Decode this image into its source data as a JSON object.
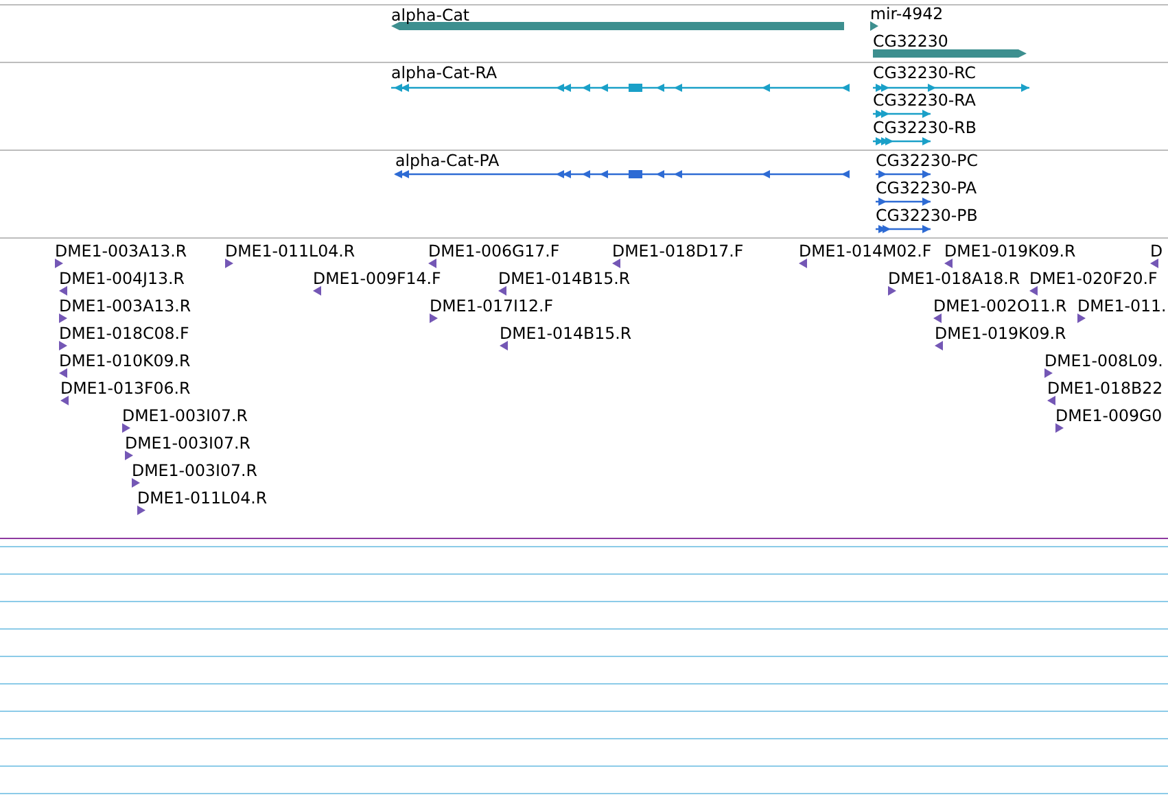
{
  "tracks": [
    {
      "kind": "genes",
      "features": [
        {
          "label": "alpha-Cat",
          "reverse": true
        },
        {
          "label": "mir-4942",
          "reverse": false
        },
        {
          "label": "CG32230",
          "reverse": false
        }
      ]
    },
    {
      "kind": "transcripts",
      "features": [
        {
          "label": "alpha-Cat-RA",
          "reverse": true
        },
        {
          "label": "CG32230-RC",
          "reverse": false
        },
        {
          "label": "CG32230-RA",
          "reverse": false
        },
        {
          "label": "CG32230-RB",
          "reverse": false
        }
      ]
    },
    {
      "kind": "proteins",
      "features": [
        {
          "label": "alpha-Cat-PA",
          "reverse": true
        },
        {
          "label": "CG32230-PC",
          "reverse": false
        },
        {
          "label": "CG32230-PA",
          "reverse": false
        },
        {
          "label": "CG32230-PB",
          "reverse": false
        }
      ]
    },
    {
      "kind": "clones",
      "features": [
        {
          "label": "DME1-003A13.R",
          "reverse": false
        },
        {
          "label": "DME1-011L04.R",
          "reverse": false
        },
        {
          "label": "DME1-006G17.F",
          "reverse": true
        },
        {
          "label": "DME1-018D17.F",
          "reverse": true
        },
        {
          "label": "DME1-014M02.F",
          "reverse": true
        },
        {
          "label": "DME1-019K09.R",
          "reverse": true
        },
        {
          "label": "D",
          "reverse": true
        },
        {
          "label": "DME1-004J13.R",
          "reverse": true
        },
        {
          "label": "DME1-009F14.F",
          "reverse": true
        },
        {
          "label": "DME1-014B15.R",
          "reverse": true
        },
        {
          "label": "DME1-018A18.R",
          "reverse": false
        },
        {
          "label": "DME1-020F20.F",
          "reverse": true
        },
        {
          "label": "DME1-003A13.R",
          "reverse": false
        },
        {
          "label": "DME1-017I12.F",
          "reverse": false
        },
        {
          "label": "DME1-002O11.R",
          "reverse": true
        },
        {
          "label": "DME1-011.",
          "reverse": false
        },
        {
          "label": "DME1-018C08.F",
          "reverse": false
        },
        {
          "label": "DME1-014B15.R",
          "reverse": true
        },
        {
          "label": "DME1-019K09.R",
          "reverse": true
        },
        {
          "label": "DME1-010K09.R",
          "reverse": true
        },
        {
          "label": "DME1-008L09.",
          "reverse": false
        },
        {
          "label": "DME1-013F06.R",
          "reverse": true
        },
        {
          "label": "DME1-018B22",
          "reverse": true
        },
        {
          "label": "DME1-003I07.R",
          "reverse": false
        },
        {
          "label": "DME1-009G0",
          "reverse": false
        },
        {
          "label": "DME1-003I07.R",
          "reverse": false
        },
        {
          "label": "DME1-003I07.R",
          "reverse": false
        },
        {
          "label": "DME1-011L04.R",
          "reverse": false
        }
      ]
    }
  ]
}
